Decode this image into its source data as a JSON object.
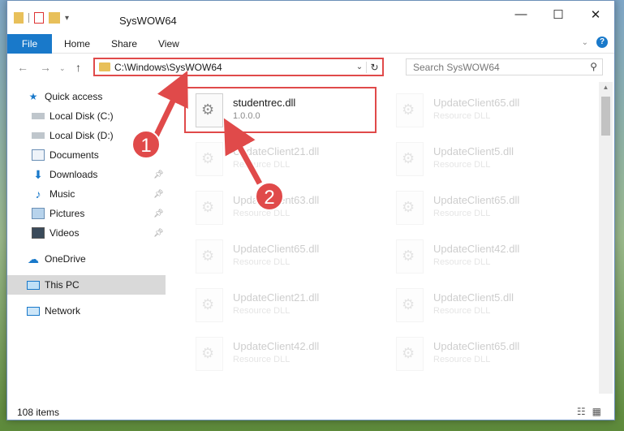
{
  "window": {
    "title": "SysWOW64",
    "controls": {
      "minimize": "—",
      "maximize": "☐",
      "close": "✕"
    }
  },
  "ribbon": {
    "tabs": [
      "File",
      "Home",
      "Share",
      "View"
    ]
  },
  "address": {
    "path": "C:\\Windows\\SysWOW64"
  },
  "search": {
    "placeholder": "Search SysWOW64"
  },
  "sidebar": {
    "items": [
      {
        "label": "Quick access",
        "icon": "star-icon"
      },
      {
        "label": "Local Disk (C:)",
        "icon": "drive-icon"
      },
      {
        "label": "Local Disk (D:)",
        "icon": "drive-icon"
      },
      {
        "label": "Documents",
        "icon": "documents-icon"
      },
      {
        "label": "Downloads",
        "icon": "download-icon",
        "pinned": true
      },
      {
        "label": "Music",
        "icon": "music-icon",
        "pinned": true
      },
      {
        "label": "Pictures",
        "icon": "pictures-icon",
        "pinned": true
      },
      {
        "label": "Videos",
        "icon": "videos-icon",
        "pinned": true
      },
      {
        "label": "OneDrive",
        "icon": "cloud-icon"
      },
      {
        "label": "This PC",
        "icon": "computer-icon",
        "selected": true
      },
      {
        "label": "Network",
        "icon": "network-icon"
      }
    ]
  },
  "files": [
    {
      "name": "studentrec.dll",
      "sub": "1.0.0.0"
    },
    {
      "name": "UpdateClient65.dll",
      "sub": "Resource DLL"
    },
    {
      "name": "UpdateClient21.dll",
      "sub": "Resource DLL"
    },
    {
      "name": "UpdateClient5.dll",
      "sub": "Resource DLL"
    },
    {
      "name": "UpdateClient63.dll",
      "sub": "Resource DLL"
    },
    {
      "name": "UpdateClient65.dll",
      "sub": "Resource DLL"
    },
    {
      "name": "UpdateClient65.dll",
      "sub": "Resource DLL"
    },
    {
      "name": "UpdateClient42.dll",
      "sub": "Resource DLL"
    },
    {
      "name": "UpdateClient21.dll",
      "sub": "Resource DLL"
    },
    {
      "name": "UpdateClient5.dll",
      "sub": "Resource DLL"
    },
    {
      "name": "UpdateClient42.dll",
      "sub": "Resource DLL"
    },
    {
      "name": "UpdateClient65.dll",
      "sub": "Resource DLL"
    }
  ],
  "status": {
    "count": "108 items"
  },
  "callouts": [
    "1",
    "2"
  ],
  "colors": {
    "accent": "#1979ca",
    "highlight": "#e04a4a"
  }
}
